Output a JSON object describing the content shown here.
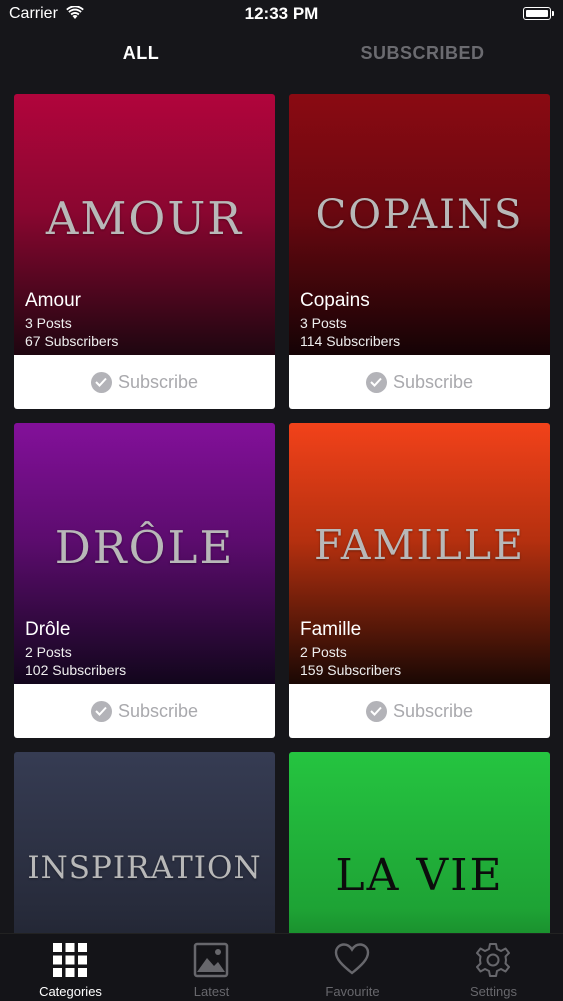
{
  "status_bar": {
    "carrier": "Carrier",
    "time": "12:33 PM"
  },
  "tabs": {
    "all": "ALL",
    "subscribed": "SUBSCRIBED"
  },
  "cards": [
    {
      "word": "AMOUR",
      "title": "Amour",
      "posts": "3 Posts",
      "subscribers": "67 Subscribers",
      "button": "Subscribe",
      "color_top": "#b1053c",
      "color_bottom": "#1e0610"
    },
    {
      "word": "COPAINS",
      "title": "Copains",
      "posts": "3 Posts",
      "subscribers": "114 Subscribers",
      "button": "Subscribe",
      "color_top": "#8a0a12",
      "color_bottom": "#150305"
    },
    {
      "word": "DRÔLE",
      "title": "Drôle",
      "posts": "2 Posts",
      "subscribers": "102 Subscribers",
      "button": "Subscribe",
      "color_top": "#83109a",
      "color_bottom": "#12061c"
    },
    {
      "word": "FAMILLE",
      "title": "Famille",
      "posts": "2 Posts",
      "subscribers": "159 Subscribers",
      "button": "Subscribe",
      "color_top": "#f2421a",
      "color_bottom": "#1a0804"
    },
    {
      "word": "INSPIRATION",
      "color_top": "#363c53",
      "color_bottom": "#1a1c25"
    },
    {
      "word": "LA VIE",
      "color_top": "#25c440",
      "color_bottom": "#0f5a18"
    }
  ],
  "tabbar": {
    "categories": "Categories",
    "latest": "Latest",
    "favourite": "Favourite",
    "settings": "Settings"
  }
}
